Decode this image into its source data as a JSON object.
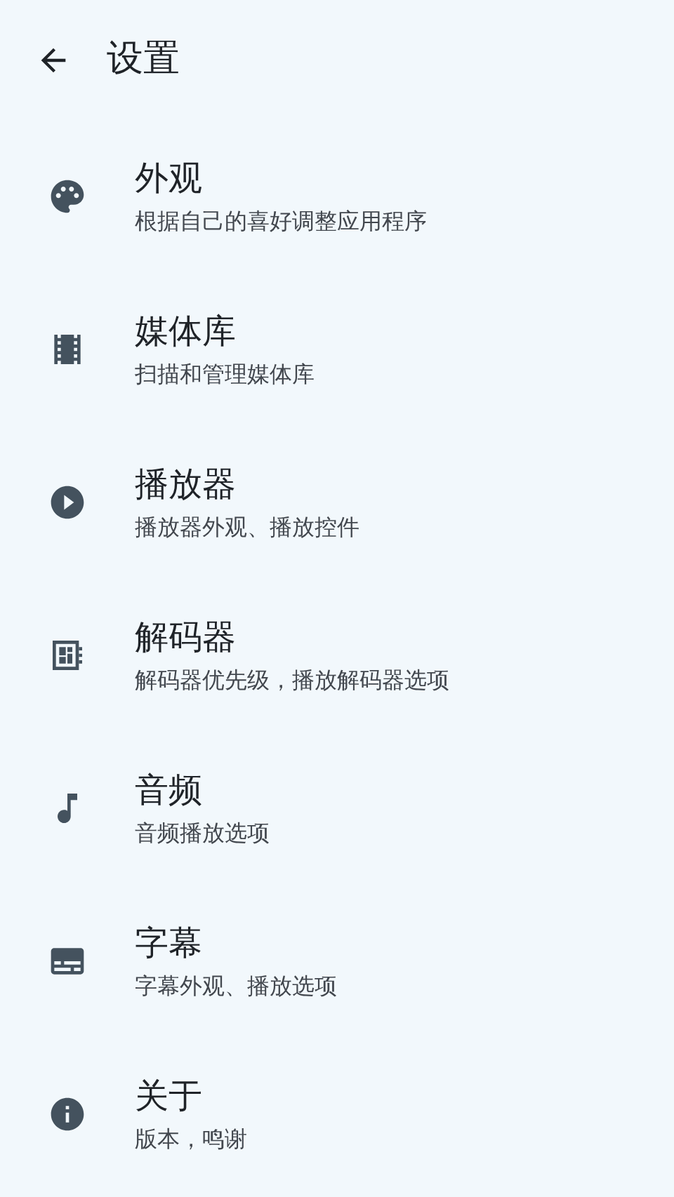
{
  "app_bar": {
    "title": "设置"
  },
  "items": [
    {
      "kind": "palette",
      "title": "外观",
      "subtitle": "根据自己的喜好调整应用程序"
    },
    {
      "kind": "film",
      "title": "媒体库",
      "subtitle": "扫描和管理媒体库"
    },
    {
      "kind": "play",
      "title": "播放器",
      "subtitle": "播放器外观、播放控件"
    },
    {
      "kind": "chip",
      "title": "解码器",
      "subtitle": "解码器优先级，播放解码器选项"
    },
    {
      "kind": "note",
      "title": "音频",
      "subtitle": "音频播放选项"
    },
    {
      "kind": "subtitles",
      "title": "字幕",
      "subtitle": "字幕外观、播放选项"
    },
    {
      "kind": "info",
      "title": "关于",
      "subtitle": "版本，鸣谢"
    }
  ]
}
